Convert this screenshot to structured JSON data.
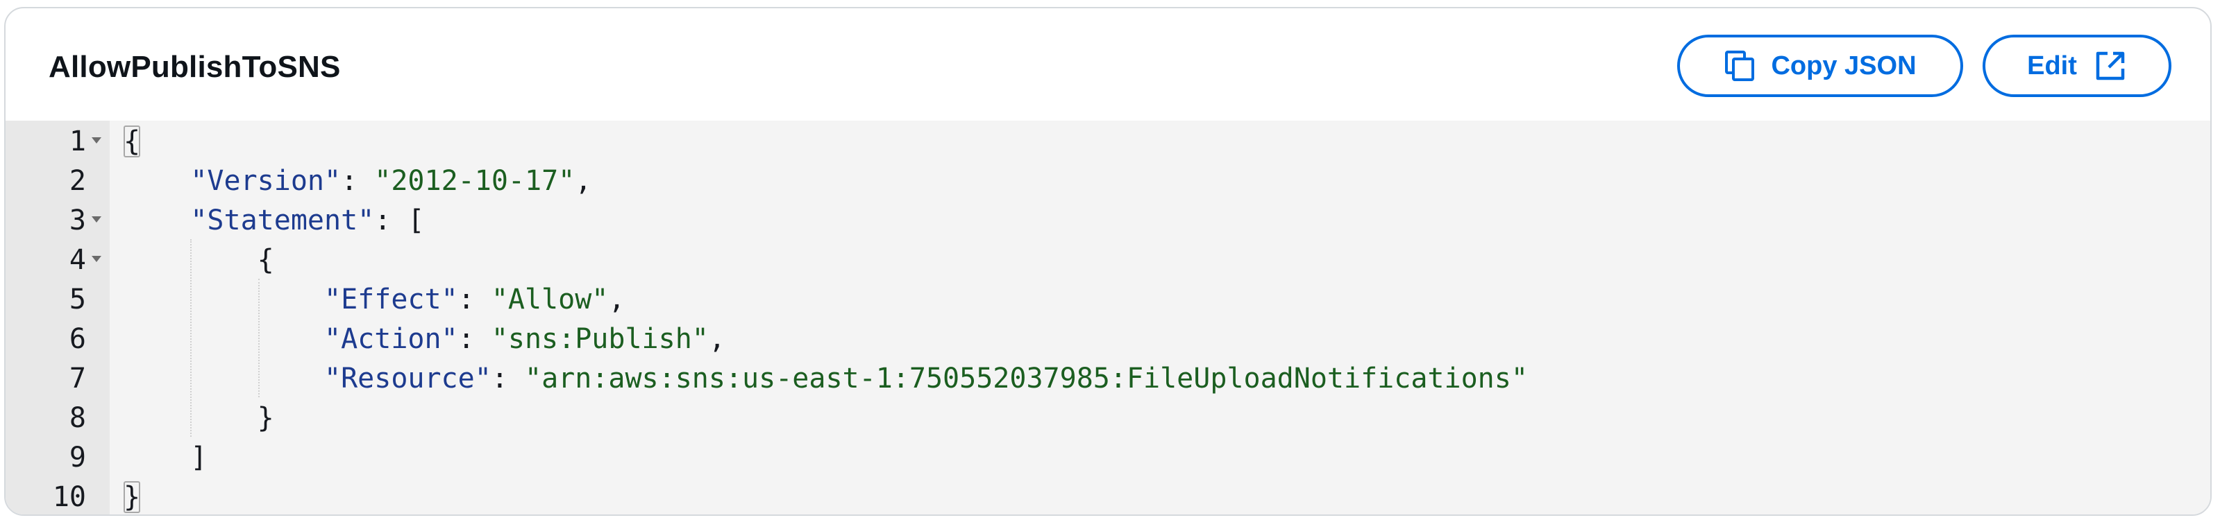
{
  "panel": {
    "title": "AllowPublishToSNS"
  },
  "actions": {
    "copy_label": "Copy JSON",
    "copy_icon": "copy-icon",
    "edit_label": "Edit",
    "edit_icon": "external-link-icon"
  },
  "colors": {
    "accent": "#006ce0",
    "key": "#1d3b8f",
    "string": "#1b5e20",
    "gutter": "#e8e8e8",
    "editor_bg": "#f4f4f4"
  },
  "editor": {
    "lines": [
      {
        "num": "1",
        "fold": true,
        "tokens": [
          {
            "t": "{",
            "c": "punc",
            "hl": true
          }
        ]
      },
      {
        "num": "2",
        "fold": false,
        "tokens": [
          {
            "t": "    ",
            "c": "punc"
          },
          {
            "t": "\"Version\"",
            "c": "key"
          },
          {
            "t": ": ",
            "c": "punc"
          },
          {
            "t": "\"2012-10-17\"",
            "c": "str"
          },
          {
            "t": ",",
            "c": "punc"
          }
        ]
      },
      {
        "num": "3",
        "fold": true,
        "tokens": [
          {
            "t": "    ",
            "c": "punc"
          },
          {
            "t": "\"Statement\"",
            "c": "key"
          },
          {
            "t": ": [",
            "c": "punc"
          }
        ]
      },
      {
        "num": "4",
        "fold": true,
        "tokens": [
          {
            "t": "        {",
            "c": "punc"
          }
        ]
      },
      {
        "num": "5",
        "fold": false,
        "tokens": [
          {
            "t": "            ",
            "c": "punc"
          },
          {
            "t": "\"Effect\"",
            "c": "key"
          },
          {
            "t": ": ",
            "c": "punc"
          },
          {
            "t": "\"Allow\"",
            "c": "str"
          },
          {
            "t": ",",
            "c": "punc"
          }
        ]
      },
      {
        "num": "6",
        "fold": false,
        "tokens": [
          {
            "t": "            ",
            "c": "punc"
          },
          {
            "t": "\"Action\"",
            "c": "key"
          },
          {
            "t": ": ",
            "c": "punc"
          },
          {
            "t": "\"sns:Publish\"",
            "c": "str"
          },
          {
            "t": ",",
            "c": "punc"
          }
        ]
      },
      {
        "num": "7",
        "fold": false,
        "tokens": [
          {
            "t": "            ",
            "c": "punc"
          },
          {
            "t": "\"Resource\"",
            "c": "key"
          },
          {
            "t": ": ",
            "c": "punc"
          },
          {
            "t": "\"arn:aws:sns:us-east-1:750552037985:FileUploadNotifications\"",
            "c": "str"
          }
        ]
      },
      {
        "num": "8",
        "fold": false,
        "tokens": [
          {
            "t": "        }",
            "c": "punc"
          }
        ]
      },
      {
        "num": "9",
        "fold": false,
        "tokens": [
          {
            "t": "    ]",
            "c": "punc"
          }
        ]
      },
      {
        "num": "10",
        "fold": false,
        "tokens": [
          {
            "t": "}",
            "c": "punc",
            "hl": true
          }
        ]
      }
    ]
  }
}
